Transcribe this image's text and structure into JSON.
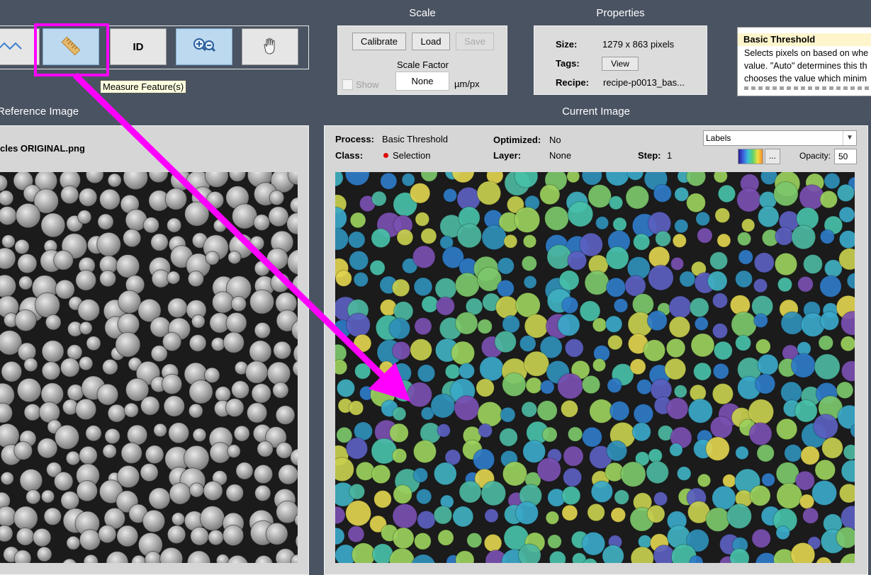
{
  "toolbar": {
    "buttons": [
      {
        "name": "line-profile-icon"
      },
      {
        "name": "ruler-icon"
      },
      {
        "label": "ID"
      },
      {
        "name": "zoom-icon"
      },
      {
        "name": "hand-pan-icon"
      }
    ],
    "tooltip": "Measure Feature(s)"
  },
  "scale": {
    "title": "Scale",
    "calibrate_label": "Calibrate",
    "load_label": "Load",
    "save_label": "Save",
    "scale_factor_label": "Scale Factor",
    "scale_factor_value": "None",
    "unit": "µm/px",
    "show_label": "Show"
  },
  "properties": {
    "title": "Properties",
    "size_label": "Size:",
    "size_value": "1279 x 863 pixels",
    "tags_label": "Tags:",
    "view_label": "View",
    "recipe_label": "Recipe:",
    "recipe_value": "recipe-p0013_bas..."
  },
  "help": {
    "title": "Basic Threshold",
    "line1": "Selects pixels on based on whe",
    "line2": "value. \"Auto\" determines this th",
    "line3": "chooses the value which minim"
  },
  "reference": {
    "title": "Reference Image",
    "filename": "cles ORIGINAL.png"
  },
  "current": {
    "title": "Current Image",
    "process_label": "Process:",
    "process_value": "Basic Threshold",
    "optimized_label": "Optimized:",
    "optimized_value": "No",
    "class_label": "Class:",
    "class_value": "Selection",
    "layer_label": "Layer:",
    "layer_value": "None",
    "step_label": "Step:",
    "step_value": "1",
    "overlay_option": "Labels",
    "more_label": "...",
    "opacity_label": "Opacity:",
    "opacity_value": "50"
  },
  "colors": {
    "background": "#4a5361",
    "highlight": "#ff00ff",
    "class_dot": "#e00000",
    "active_button": "#bcd9ef"
  }
}
